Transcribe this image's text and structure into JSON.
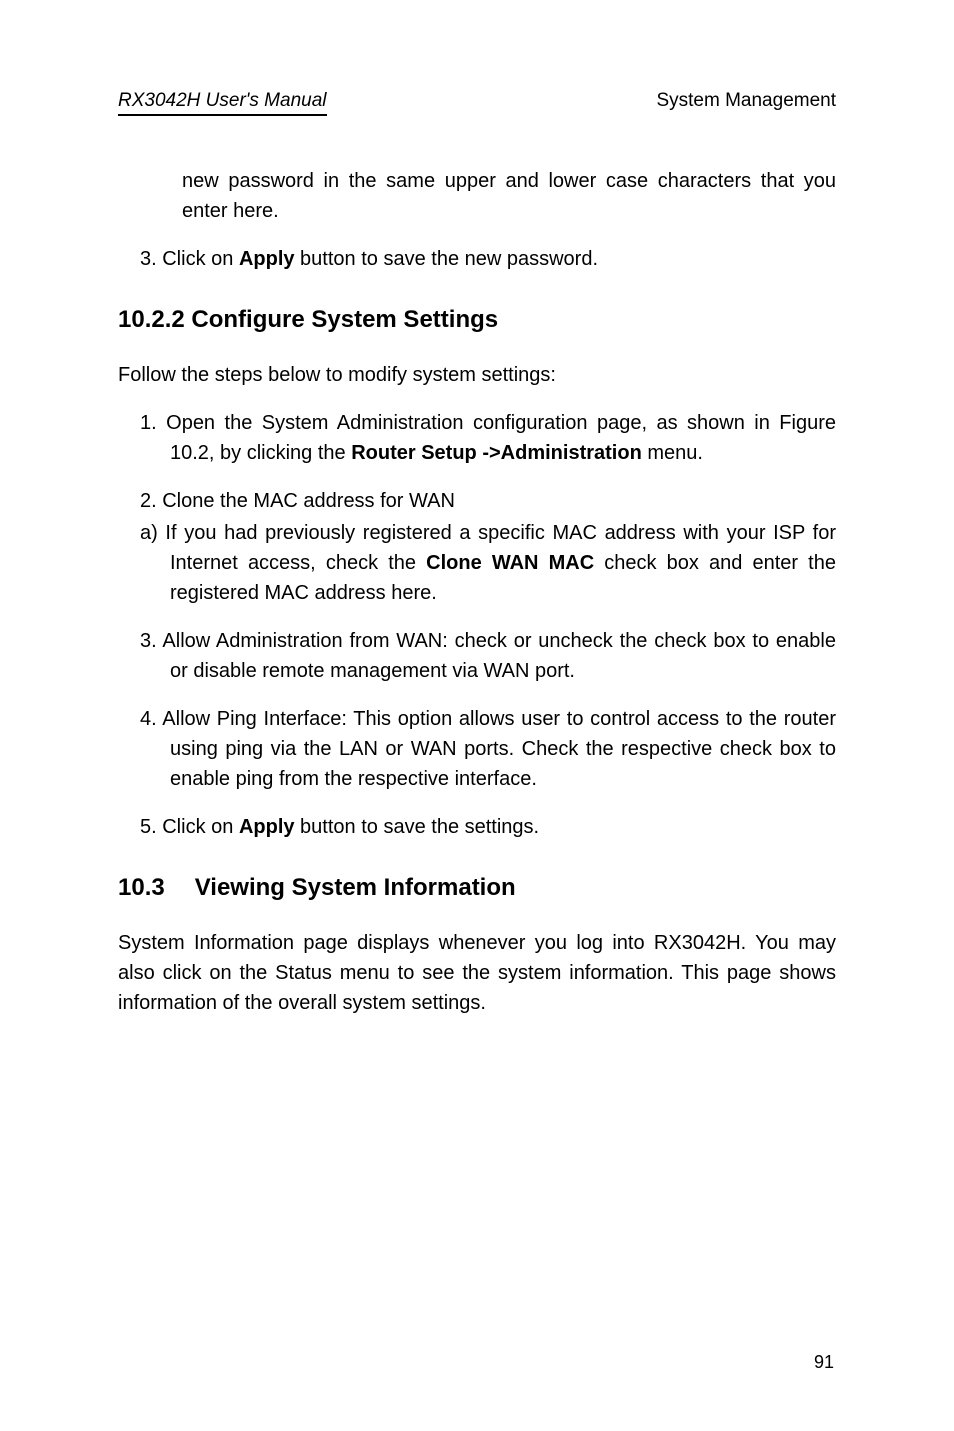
{
  "header": {
    "left": "RX3042H User's Manual",
    "right": "System Management"
  },
  "body": {
    "cont1": "new password in the same upper and lower case characters that you enter here.",
    "item_3a_pre": "3. Click on ",
    "apply": "Apply",
    "item_3a_post": " button to save the new password."
  },
  "sec_10_2_2": {
    "heading": "10.2.2  Configure System Settings",
    "intro": "Follow the steps below to modify system settings:",
    "item1_pre": "1. Open the System Administration configuration page, as shown in Figure 10.2, by clicking the ",
    "item1_bold": "Router Setup ->Administration",
    "item1_post": " menu.",
    "item2": "2. Clone the MAC address for WAN",
    "item2a_pre": "a) If you had previously registered a specific MAC address with your ISP for Internet access, check the ",
    "item2a_bold": "Clone WAN MAC",
    "item2a_post": " check box and enter the registered MAC address here.",
    "item3": "3. Allow Administration from WAN: check or uncheck the check box to enable or disable remote management via WAN port.",
    "item4": "4. Allow Ping Interface: This option allows user to control access to the router using ping via the LAN or WAN ports. Check the respective check box to enable ping from the respective interface.",
    "item5_pre": "5. Click on ",
    "item5_bold": "Apply",
    "item5_post": " button to save the settings."
  },
  "sec_10_3": {
    "number": "10.3",
    "title": "Viewing System Information",
    "para": "System Information page displays whenever you log into RX3042H. You may also click on the Status menu to see the system information. This page shows information of the overall system settings."
  },
  "page_number": "91"
}
